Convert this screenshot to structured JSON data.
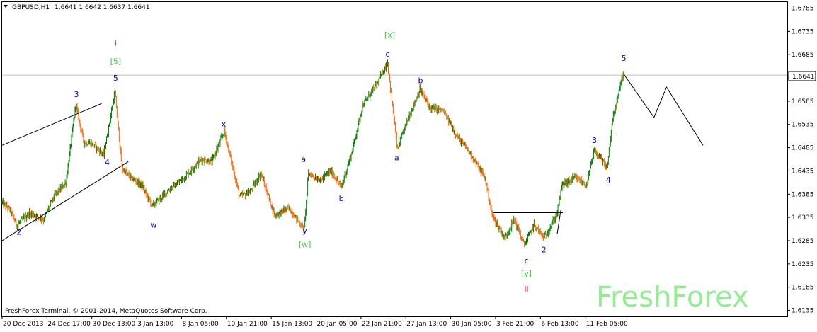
{
  "header": {
    "symbol_title": "GBPUSD,H1",
    "ohlc": "1.6641 1.6642 1.6637 1.6641",
    "triangle_icon": "dropdown-triangle-icon"
  },
  "footer": {
    "copyright": "FreshForex Terminal, © 2001-2014, MetaQuotes Software Corp.",
    "watermark": "FreshForex"
  },
  "colors": {
    "background": "#ffffff",
    "frame": "#000000",
    "candle_up": "#008000",
    "candle_down": "#ff6600",
    "wave_blue": "#0000cc",
    "wave_green": "#33cc33",
    "wave_red": "#ff0000",
    "price_line": "#c0c0c0",
    "watermark": "#90ee90"
  },
  "chart_data": {
    "type": "candlestick",
    "symbol": "GBPUSD",
    "timeframe": "H1",
    "y_axis": {
      "ticks": [
        "1.6785",
        "1.6735",
        "1.6685",
        "1.6635",
        "1.6585",
        "1.6535",
        "1.6485",
        "1.6435",
        "1.6385",
        "1.6335",
        "1.6285",
        "1.6235",
        "1.6185",
        "1.6135"
      ],
      "ylim": [
        1.6122,
        1.6798
      ],
      "current_price": 1.6641,
      "current_price_label": "1.6641"
    },
    "x_axis": {
      "ticks": [
        "20 Dec 2013",
        "24 Dec 17:00",
        "30 Dec 13:00",
        "3 Jan 13:00",
        "8 Jan 05:00",
        "10 Jan 21:00",
        "15 Jan 13:00",
        "20 Jan 05:00",
        "22 Jan 21:00",
        "27 Jan 13:00",
        "30 Jan 05:00",
        "3 Feb 21:00",
        "6 Feb 13:00",
        "11 Feb 05:00"
      ],
      "bar_count": 884,
      "tick_bar_index": [
        0,
        64,
        128,
        192,
        256,
        320,
        384,
        448,
        512,
        576,
        640,
        704,
        768,
        832
      ]
    },
    "price_path": [
      {
        "bar": 0,
        "price": 1.6368
      },
      {
        "bar": 12,
        "price": 1.6352
      },
      {
        "bar": 22,
        "price": 1.6318
      },
      {
        "bar": 40,
        "price": 1.6345
      },
      {
        "bar": 60,
        "price": 1.633
      },
      {
        "bar": 75,
        "price": 1.638
      },
      {
        "bar": 92,
        "price": 1.641
      },
      {
        "bar": 106,
        "price": 1.6578
      },
      {
        "bar": 118,
        "price": 1.6495
      },
      {
        "bar": 128,
        "price": 1.6495
      },
      {
        "bar": 146,
        "price": 1.647
      },
      {
        "bar": 162,
        "price": 1.6605
      },
      {
        "bar": 172,
        "price": 1.644
      },
      {
        "bar": 185,
        "price": 1.642
      },
      {
        "bar": 200,
        "price": 1.6405
      },
      {
        "bar": 215,
        "price": 1.636
      },
      {
        "bar": 240,
        "price": 1.6395
      },
      {
        "bar": 260,
        "price": 1.642
      },
      {
        "bar": 285,
        "price": 1.646
      },
      {
        "bar": 300,
        "price": 1.6455
      },
      {
        "bar": 318,
        "price": 1.652
      },
      {
        "bar": 340,
        "price": 1.638
      },
      {
        "bar": 355,
        "price": 1.639
      },
      {
        "bar": 370,
        "price": 1.643
      },
      {
        "bar": 390,
        "price": 1.634
      },
      {
        "bar": 410,
        "price": 1.6355
      },
      {
        "bar": 432,
        "price": 1.631
      },
      {
        "bar": 438,
        "price": 1.643
      },
      {
        "bar": 455,
        "price": 1.6415
      },
      {
        "bar": 470,
        "price": 1.6435
      },
      {
        "bar": 485,
        "price": 1.64
      },
      {
        "bar": 500,
        "price": 1.6475
      },
      {
        "bar": 515,
        "price": 1.6575
      },
      {
        "bar": 535,
        "price": 1.662
      },
      {
        "bar": 551,
        "price": 1.6668
      },
      {
        "bar": 556,
        "price": 1.66
      },
      {
        "bar": 565,
        "price": 1.648
      },
      {
        "bar": 578,
        "price": 1.654
      },
      {
        "bar": 597,
        "price": 1.661
      },
      {
        "bar": 612,
        "price": 1.657
      },
      {
        "bar": 630,
        "price": 1.6565
      },
      {
        "bar": 650,
        "price": 1.651
      },
      {
        "bar": 670,
        "price": 1.647
      },
      {
        "bar": 690,
        "price": 1.642
      },
      {
        "bar": 700,
        "price": 1.634
      },
      {
        "bar": 718,
        "price": 1.629
      },
      {
        "bar": 732,
        "price": 1.633
      },
      {
        "bar": 746,
        "price": 1.6275
      },
      {
        "bar": 760,
        "price": 1.632
      },
      {
        "bar": 774,
        "price": 1.629
      },
      {
        "bar": 792,
        "price": 1.634
      },
      {
        "bar": 800,
        "price": 1.6405
      },
      {
        "bar": 818,
        "price": 1.642
      },
      {
        "bar": 835,
        "price": 1.6405
      },
      {
        "bar": 846,
        "price": 1.648
      },
      {
        "bar": 864,
        "price": 1.644
      },
      {
        "bar": 872,
        "price": 1.6545
      },
      {
        "bar": 887,
        "price": 1.6645
      }
    ],
    "trend_lines": [
      {
        "from": {
          "bar": 0,
          "price": 1.649
        },
        "to": {
          "bar": 142,
          "price": 1.658
        }
      },
      {
        "from": {
          "bar": 0,
          "price": 1.6285
        },
        "to": {
          "bar": 180,
          "price": 1.6455
        }
      },
      {
        "from": {
          "bar": 700,
          "price": 1.6345
        },
        "to": {
          "bar": 800,
          "price": 1.6345
        }
      },
      {
        "from": {
          "bar": 792,
          "price": 1.63
        },
        "to": {
          "bar": 797,
          "price": 1.635
        }
      }
    ],
    "projection": [
      {
        "bar": 887,
        "price": 1.6643
      },
      {
        "bar": 930,
        "price": 1.655
      },
      {
        "bar": 948,
        "price": 1.6615
      },
      {
        "bar": 1000,
        "price": 1.649
      }
    ],
    "annotations": [
      {
        "text": "i",
        "color": "red",
        "bar": 162,
        "price": 1.6704
      },
      {
        "text": "[5]",
        "color": "green",
        "bar": 162,
        "price": 1.6665
      },
      {
        "text": "5",
        "color": "blue",
        "bar": 162,
        "price": 1.6629
      },
      {
        "text": "3",
        "color": "blue",
        "bar": 106,
        "price": 1.6594
      },
      {
        "text": "4",
        "color": "blue",
        "bar": 150,
        "price": 1.6448
      },
      {
        "text": "2",
        "color": "blue",
        "bar": 24,
        "price": 1.6298
      },
      {
        "text": "w",
        "color": "blue",
        "bar": 216,
        "price": 1.6313
      },
      {
        "text": "x",
        "color": "blue",
        "bar": 316,
        "price": 1.653
      },
      {
        "text": "a",
        "color": "blue",
        "bar": 430,
        "price": 1.6455
      },
      {
        "text": "y",
        "color": "blue",
        "bar": 432,
        "price": 1.6301
      },
      {
        "text": "[w]",
        "color": "green",
        "bar": 432,
        "price": 1.6271
      },
      {
        "text": "b",
        "color": "blue",
        "bar": 484,
        "price": 1.637
      },
      {
        "text": "[x]",
        "color": "green",
        "bar": 553,
        "price": 1.6722
      },
      {
        "text": "c",
        "color": "blue",
        "bar": 550,
        "price": 1.6681
      },
      {
        "text": "a",
        "color": "blue",
        "bar": 563,
        "price": 1.6458
      },
      {
        "text": "b",
        "color": "blue",
        "bar": 597,
        "price": 1.6624
      },
      {
        "text": "c",
        "color": "blue",
        "bar": 748,
        "price": 1.6236
      },
      {
        "text": "[y]",
        "color": "green",
        "bar": 748,
        "price": 1.6209
      },
      {
        "text": "ii",
        "color": "red",
        "bar": 748,
        "price": 1.6175
      },
      {
        "text": "2",
        "color": "blue",
        "bar": 773,
        "price": 1.626
      },
      {
        "text": "3",
        "color": "blue",
        "bar": 845,
        "price": 1.6495
      },
      {
        "text": "4",
        "color": "blue",
        "bar": 865,
        "price": 1.641
      },
      {
        "text": "5",
        "color": "blue",
        "bar": 887,
        "price": 1.6672
      }
    ]
  }
}
